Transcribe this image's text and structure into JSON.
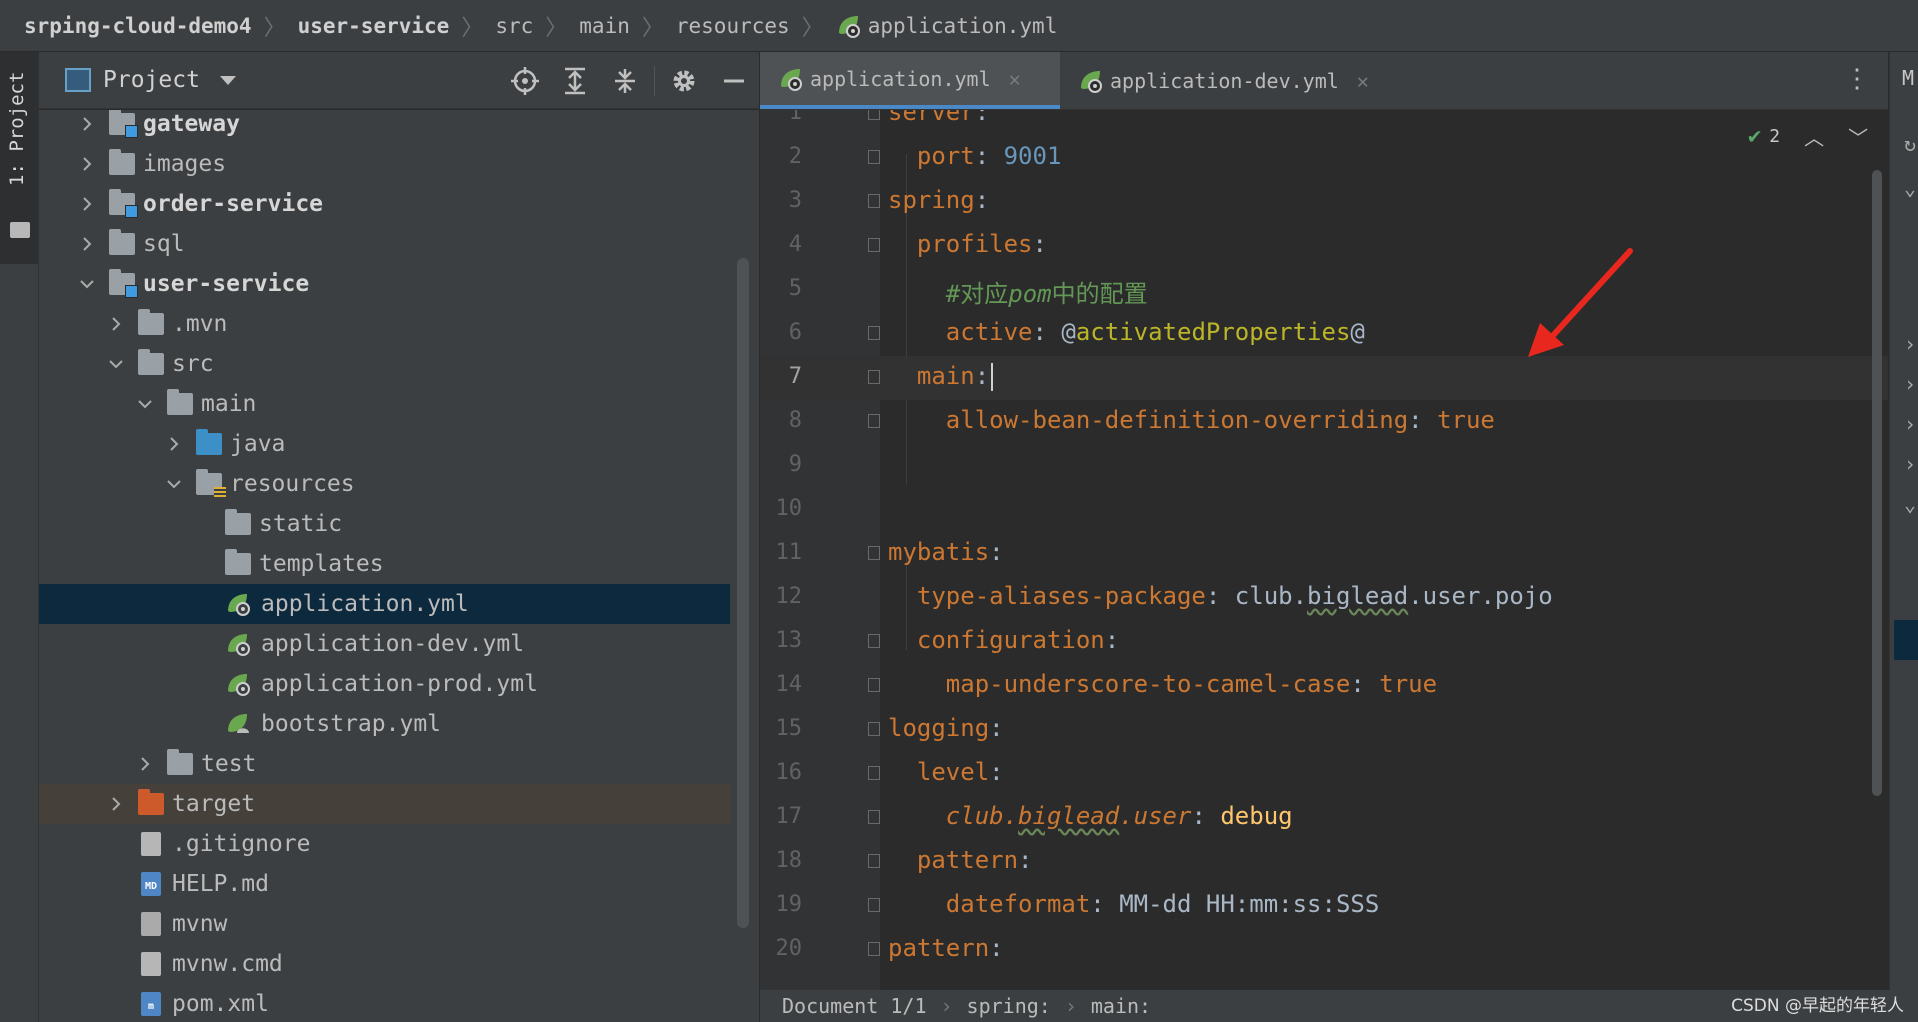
{
  "breadcrumb": {
    "items": [
      "srping-cloud-demo4",
      "user-service",
      "src",
      "main",
      "resources",
      "application.yml"
    ]
  },
  "left_strip": {
    "tab_label": "1: Project"
  },
  "project_panel": {
    "title": "Project",
    "toolbar_icons": [
      "locate-icon",
      "expand-all-icon",
      "collapse-all-icon",
      "gear-icon",
      "minimize-icon"
    ],
    "tree": [
      {
        "label": "gateway",
        "depth": 0,
        "expander": "collapsed",
        "icon": "module-folder",
        "bold": true
      },
      {
        "label": "images",
        "depth": 0,
        "expander": "collapsed",
        "icon": "folder",
        "bold": false
      },
      {
        "label": "order-service",
        "depth": 0,
        "expander": "collapsed",
        "icon": "module-folder",
        "bold": true
      },
      {
        "label": "sql",
        "depth": 0,
        "expander": "collapsed",
        "icon": "folder",
        "bold": false
      },
      {
        "label": "user-service",
        "depth": 0,
        "expander": "expanded",
        "icon": "module-folder",
        "bold": true
      },
      {
        "label": ".mvn",
        "depth": 1,
        "expander": "collapsed",
        "icon": "folder",
        "bold": false
      },
      {
        "label": "src",
        "depth": 1,
        "expander": "expanded",
        "icon": "folder",
        "bold": false
      },
      {
        "label": "main",
        "depth": 2,
        "expander": "expanded",
        "icon": "folder",
        "bold": false
      },
      {
        "label": "java",
        "depth": 3,
        "expander": "collapsed",
        "icon": "source-folder",
        "bold": false
      },
      {
        "label": "resources",
        "depth": 3,
        "expander": "expanded",
        "icon": "resources-folder",
        "bold": false
      },
      {
        "label": "static",
        "depth": 4,
        "expander": "none",
        "icon": "folder",
        "bold": false
      },
      {
        "label": "templates",
        "depth": 4,
        "expander": "none",
        "icon": "folder",
        "bold": false
      },
      {
        "label": "application.yml",
        "depth": 4,
        "expander": "none",
        "icon": "spring-config",
        "bold": false,
        "selected": true
      },
      {
        "label": "application-dev.yml",
        "depth": 4,
        "expander": "none",
        "icon": "spring-config",
        "bold": false
      },
      {
        "label": "application-prod.yml",
        "depth": 4,
        "expander": "none",
        "icon": "spring-config",
        "bold": false
      },
      {
        "label": "bootstrap.yml",
        "depth": 4,
        "expander": "none",
        "icon": "spring-bootstrap",
        "bold": false
      },
      {
        "label": "test",
        "depth": 2,
        "expander": "collapsed",
        "icon": "folder",
        "bold": false
      },
      {
        "label": "target",
        "depth": 1,
        "expander": "collapsed",
        "icon": "excluded-folder",
        "bold": false,
        "excluded": true
      },
      {
        "label": ".gitignore",
        "depth": 1,
        "expander": "none",
        "icon": "file-ignore",
        "bold": false
      },
      {
        "label": "HELP.md",
        "depth": 1,
        "expander": "none",
        "icon": "file-md",
        "bold": false
      },
      {
        "label": "mvnw",
        "depth": 1,
        "expander": "none",
        "icon": "file-terminal",
        "bold": false
      },
      {
        "label": "mvnw.cmd",
        "depth": 1,
        "expander": "none",
        "icon": "file-text",
        "bold": false
      },
      {
        "label": "pom.xml",
        "depth": 1,
        "expander": "none",
        "icon": "file-maven",
        "bold": false
      }
    ]
  },
  "tabs": [
    {
      "label": "application.yml",
      "active": true
    },
    {
      "label": "application-dev.yml",
      "active": false
    }
  ],
  "right_strip": {
    "label": "M"
  },
  "inspection": {
    "count": "2"
  },
  "editor": {
    "current_line": 7,
    "lines": [
      {
        "num": "1",
        "segments": [
          {
            "t": "server",
            "c": "k"
          },
          {
            "t": ":",
            "c": "p"
          }
        ]
      },
      {
        "num": "2",
        "segments": [
          {
            "t": "  port",
            "c": "k"
          },
          {
            "t": ": ",
            "c": "p"
          },
          {
            "t": "9001",
            "c": "n"
          }
        ]
      },
      {
        "num": "3",
        "segments": [
          {
            "t": "spring",
            "c": "k"
          },
          {
            "t": ":",
            "c": "p"
          }
        ]
      },
      {
        "num": "4",
        "segments": [
          {
            "t": "  profiles",
            "c": "k"
          },
          {
            "t": ":",
            "c": "p"
          }
        ]
      },
      {
        "num": "5",
        "segments": [
          {
            "t": "    #对应",
            "c": "c"
          },
          {
            "t": "pom",
            "c": "c it-c"
          },
          {
            "t": "中的配置",
            "c": "c"
          }
        ]
      },
      {
        "num": "6",
        "segments": [
          {
            "t": "    active",
            "c": "k"
          },
          {
            "t": ": ",
            "c": "p"
          },
          {
            "t": "@",
            "c": "s"
          },
          {
            "t": "activatedProperties",
            "c": "var"
          },
          {
            "t": "@",
            "c": "s"
          }
        ]
      },
      {
        "num": "7",
        "segments": [
          {
            "t": "  main",
            "c": "k"
          },
          {
            "t": ":",
            "c": "p"
          }
        ]
      },
      {
        "num": "8",
        "segments": [
          {
            "t": "    allow-bean-definition-overriding",
            "c": "k"
          },
          {
            "t": ": ",
            "c": "p"
          },
          {
            "t": "true",
            "c": "kv"
          }
        ]
      },
      {
        "num": "9",
        "segments": []
      },
      {
        "num": "10",
        "segments": []
      },
      {
        "num": "11",
        "segments": [
          {
            "t": "mybatis",
            "c": "k"
          },
          {
            "t": ":",
            "c": "p"
          }
        ]
      },
      {
        "num": "12",
        "segments": [
          {
            "t": "  type-aliases-package",
            "c": "k"
          },
          {
            "t": ": ",
            "c": "p"
          },
          {
            "t": "club.",
            "c": "s"
          },
          {
            "t": "biglead",
            "c": "s wavy"
          },
          {
            "t": ".user.pojo",
            "c": "s"
          }
        ]
      },
      {
        "num": "13",
        "segments": [
          {
            "t": "  configuration",
            "c": "k"
          },
          {
            "t": ":",
            "c": "p"
          }
        ]
      },
      {
        "num": "14",
        "segments": [
          {
            "t": "    map-underscore-to-camel-case",
            "c": "k"
          },
          {
            "t": ": ",
            "c": "p"
          },
          {
            "t": "true",
            "c": "kv"
          }
        ]
      },
      {
        "num": "15",
        "segments": [
          {
            "t": "logging",
            "c": "k"
          },
          {
            "t": ":",
            "c": "p"
          }
        ]
      },
      {
        "num": "16",
        "segments": [
          {
            "t": "  level",
            "c": "k"
          },
          {
            "t": ":",
            "c": "p"
          }
        ]
      },
      {
        "num": "17",
        "segments": [
          {
            "t": "    club.",
            "c": "it"
          },
          {
            "t": "biglead",
            "c": "it wavy"
          },
          {
            "t": ".user",
            "c": "it"
          },
          {
            "t": ": ",
            "c": "p"
          },
          {
            "t": "debug",
            "c": "dbg"
          }
        ]
      },
      {
        "num": "18",
        "segments": [
          {
            "t": "  pattern",
            "c": "k"
          },
          {
            "t": ":",
            "c": "p"
          }
        ]
      },
      {
        "num": "19",
        "segments": [
          {
            "t": "    dateformat",
            "c": "k"
          },
          {
            "t": ": ",
            "c": "p"
          },
          {
            "t": "MM-dd HH:mm:ss:SSS",
            "c": "s"
          }
        ]
      },
      {
        "num": "20",
        "segments": [
          {
            "t": "pattern",
            "c": "k"
          },
          {
            "t": ":",
            "c": "p"
          }
        ]
      }
    ]
  },
  "status_bar": {
    "document": "Document 1/1",
    "path": [
      "spring:",
      "main:"
    ],
    "watermark": "CSDN @早起的年轻人"
  },
  "colors": {
    "keyword": "#cc7832",
    "number": "#6897bb",
    "comment": "#629755",
    "variable": "#bbb529",
    "accent_tab": "#4a88c7",
    "annotation_arrow": "#e8281e"
  }
}
